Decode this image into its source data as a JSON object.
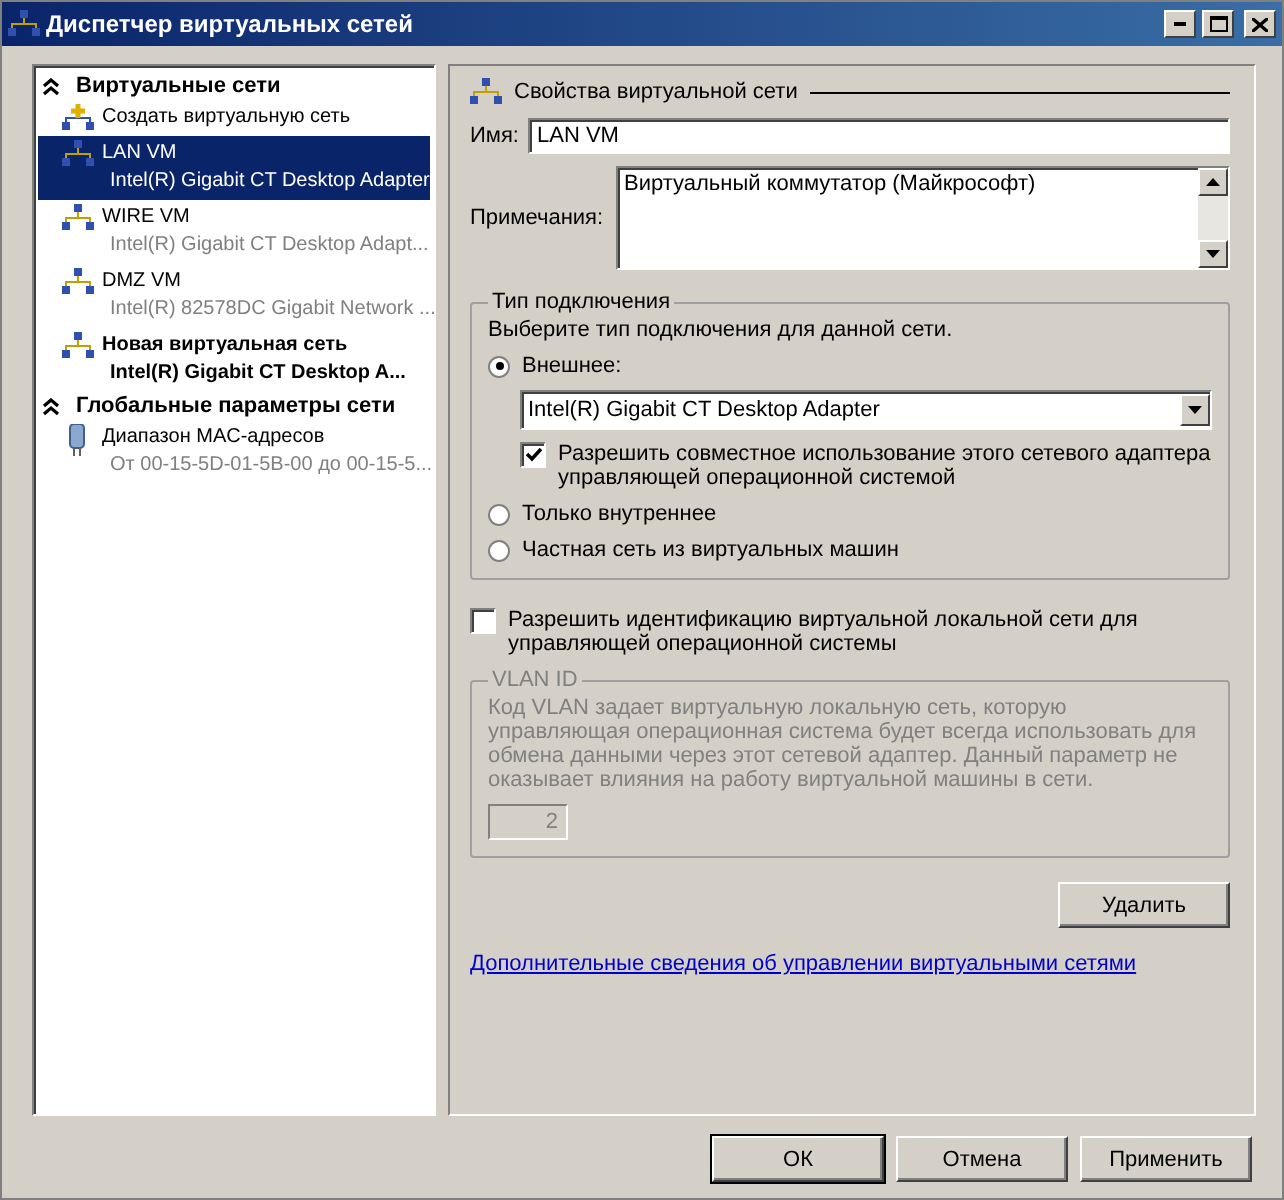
{
  "window": {
    "title": "Диспетчер виртуальных сетей"
  },
  "sidebar": {
    "sections": [
      {
        "title": "Виртуальные сети",
        "expanded": true,
        "items": [
          {
            "kind": "add",
            "title": "Создать виртуальную сеть",
            "selected": false,
            "bold": false
          },
          {
            "kind": "network",
            "title": "LAN VM",
            "subtitle": "Intel(R) Gigabit CT Desktop Adapter",
            "selected": true,
            "bold": false
          },
          {
            "kind": "network",
            "title": "WIRE VM",
            "subtitle": "Intel(R) Gigabit CT Desktop Adapt...",
            "selected": false,
            "bold": false
          },
          {
            "kind": "network",
            "title": "DMZ VM",
            "subtitle": "Intel(R) 82578DC Gigabit Network ...",
            "selected": false,
            "bold": false
          },
          {
            "kind": "network",
            "title": "Новая виртуальная сеть",
            "subtitle": "Intel(R) Gigabit CT Desktop A...",
            "selected": false,
            "bold": true
          }
        ]
      },
      {
        "title": "Глобальные параметры сети",
        "expanded": true,
        "items": [
          {
            "kind": "mac",
            "title": "Диапазон MAC-адресов",
            "subtitle": "От 00-15-5D-01-5B-00 до 00-15-5...",
            "selected": false,
            "bold": false
          }
        ]
      }
    ]
  },
  "properties": {
    "heading": "Свойства виртуальной сети",
    "name_label": "Имя:",
    "name_value": "LAN VM",
    "notes_label": "Примечания:",
    "notes_value": "Виртуальный коммутатор (Майкрософт)",
    "connection": {
      "title": "Тип подключения",
      "hint": "Выберите тип подключения для данной сети.",
      "options": [
        {
          "label": "Внешнее:",
          "selected": true,
          "adapter": "Intel(R) Gigabit CT Desktop Adapter",
          "share_label": "Разрешить совместное использование этого сетевого адаптера управляющей операционной системой",
          "share_checked": true
        },
        {
          "label": "Только внутреннее",
          "selected": false
        },
        {
          "label": "Частная сеть из виртуальных машин",
          "selected": false
        }
      ]
    },
    "vlan_label": "Разрешить идентификацию виртуальной локальной сети для управляющей операционной системы",
    "vlan_checked": false,
    "vlan": {
      "title": "VLAN ID",
      "description": "Код VLAN задает виртуальную локальную сеть, которую управляющая операционная система будет всегда использовать для обмена данными через этот сетевой адаптер. Данный параметр не оказывает влияния на работу виртуальной машины в сети.",
      "value": "2",
      "disabled": true
    },
    "remove_button": "Удалить",
    "link": "Дополнительные сведения об управлении виртуальными сетями"
  },
  "buttons": [
    {
      "label": "ОК",
      "default": true
    },
    {
      "label": "Отмена",
      "default": false
    },
    {
      "label": "Применить",
      "default": false
    }
  ]
}
